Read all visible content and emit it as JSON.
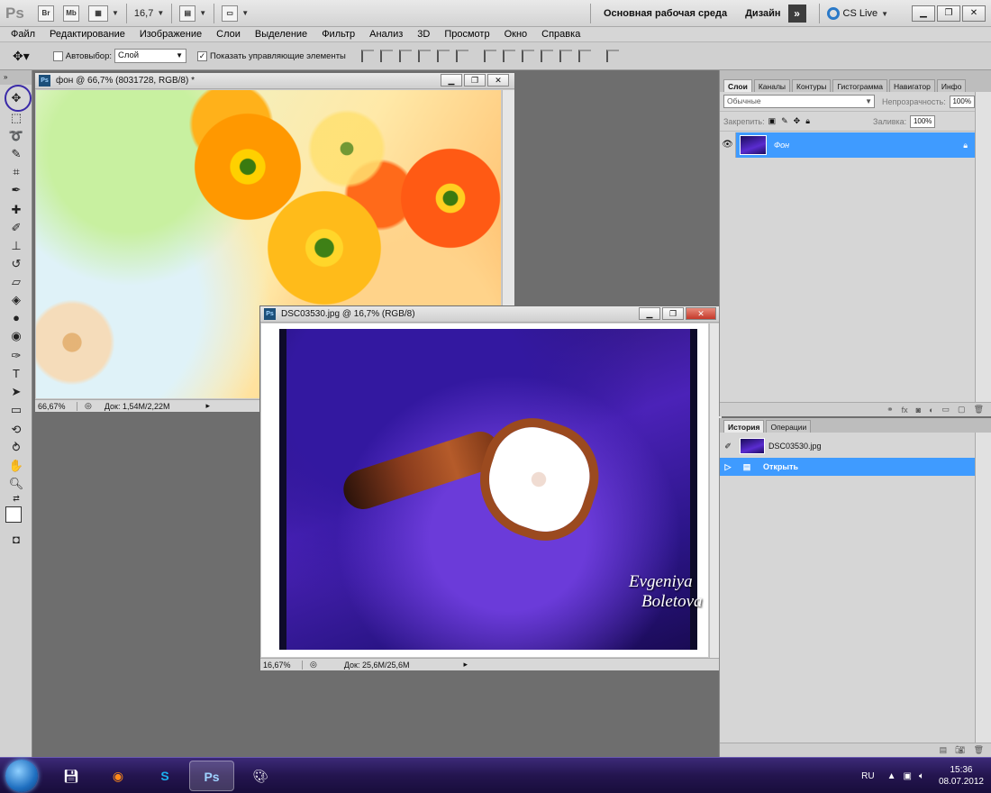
{
  "app": {
    "logo": "Ps",
    "bridge_label": "Br",
    "minibridge_label": "Mb",
    "zoom_value": "16,7",
    "workspace_label": "Основная рабочая среда",
    "design_label": "Дизайн",
    "more_label": "»",
    "cslive_label": "CS Live",
    "icons": [
      "screen-mode-icon",
      "arrange-documents-icon",
      "hand-icon",
      "cs-live-icon"
    ]
  },
  "menu": [
    "Файл",
    "Редактирование",
    "Изображение",
    "Слои",
    "Выделение",
    "Фильтр",
    "Анализ",
    "3D",
    "Просмотр",
    "Окно",
    "Справка"
  ],
  "options": {
    "autoselect_label": "Автовыбор:",
    "autoselect_value": "Слой",
    "show_controls_label": "Показать управляющие элементы"
  },
  "tools": {
    "header": "»",
    "items": [
      "move-tool",
      "marquee-tool",
      "lasso-tool",
      "quick-select-tool",
      "crop-tool",
      "eyedropper-tool",
      "spot-healing-tool",
      "brush-tool",
      "clone-stamp-tool",
      "history-brush-tool",
      "eraser-tool",
      "paint-bucket-tool",
      "blur-tool",
      "dodge-tool",
      "pen-tool",
      "type-tool",
      "path-select-tool",
      "rectangle-tool",
      "3d-rotate-tool",
      "3d-orbit-tool",
      "hand-tool",
      "zoom-tool"
    ]
  },
  "doc1": {
    "title": "фон @ 66,7% (8031728, RGB/8) *",
    "zoom": "66,67%",
    "doc_info": "Док: 1,54M/2,22M"
  },
  "doc2": {
    "title": "DSC03530.jpg @ 16,7% (RGB/8)",
    "zoom": "16,67%",
    "doc_info": "Док: 25,6M/25,6M",
    "signature_line1": "Evgeniya",
    "signature_line2": "Boletova"
  },
  "layers": {
    "tabs": [
      "Слои",
      "Каналы",
      "Контуры",
      "Гистограмма",
      "Навигатор",
      "Инфо"
    ],
    "blend_mode": "Обычные",
    "opacity_label": "Непрозрачность:",
    "opacity_value": "100%",
    "lock_label": "Закрепить:",
    "fill_label": "Заливка:",
    "fill_value": "100%",
    "layer_name": "Фон"
  },
  "history": {
    "tabs": [
      "История",
      "Операции"
    ],
    "snapshot": "DSC03530.jpg",
    "step": "Открыть"
  },
  "taskbar": {
    "lang": "RU",
    "time": "15:36",
    "date": "08.07.2012",
    "app_icons": [
      "start-orb-icon",
      "save-disk-icon",
      "firefox-icon",
      "skype-icon",
      "photoshop-icon",
      "paint-icon"
    ]
  }
}
